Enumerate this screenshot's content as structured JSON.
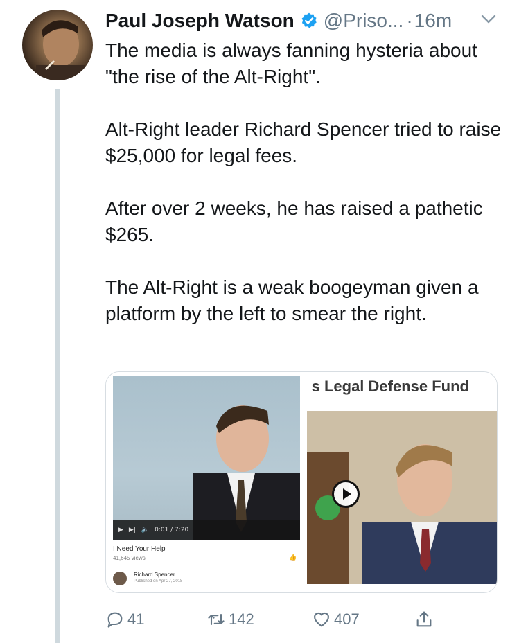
{
  "tweet": {
    "author_name": "Paul Joseph Watson",
    "handle": "@Priso...",
    "separator": "·",
    "time": "16m",
    "paragraphs": [
      "The media is always fanning hysteria about \"the rise of the Alt-Right\".",
      "Alt-Right leader Richard Spencer tried to raise $25,000 for legal fees.",
      "After over 2 weeks, he has raised a pathetic $265.",
      "The Alt-Right is a weak boogeyman given a platform by the left to smear the right."
    ]
  },
  "media": {
    "left_video": {
      "time_display": "0:01 / 7:20",
      "title": "I Need Your Help",
      "views": "41,645 views",
      "channel_name": "Richard Spencer",
      "published": "Published on Apr 27, 2018"
    },
    "right_card": {
      "title_fragment": "s Legal Defense Fund"
    }
  },
  "actions": {
    "reply_count": "41",
    "retweet_count": "142",
    "like_count": "407"
  },
  "icons": {
    "verified": "verified-badge-icon",
    "chevron": "chevron-down-icon",
    "reply": "reply-icon",
    "retweet": "retweet-icon",
    "like": "heart-icon",
    "share": "share-icon",
    "play": "play-icon"
  },
  "colors": {
    "verified_blue": "#1da1f2",
    "secondary_text": "#657786",
    "thread_line": "#cfd9de"
  }
}
